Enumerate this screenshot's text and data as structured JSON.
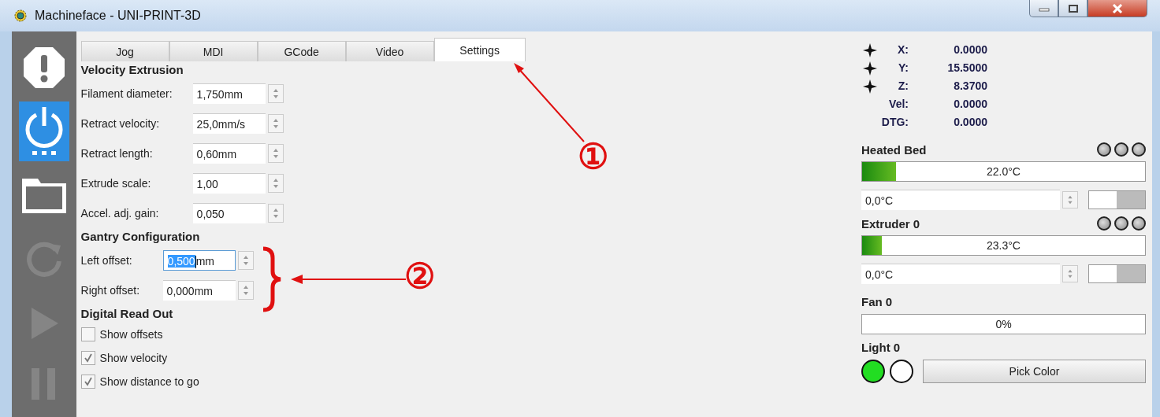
{
  "window": {
    "title": "Machineface - UNI-PRINT-3D"
  },
  "sidebar": [
    {
      "kind": "estop",
      "selected": false,
      "disabled": false
    },
    {
      "kind": "power",
      "selected": true,
      "disabled": false
    },
    {
      "kind": "folder",
      "selected": false,
      "disabled": false
    },
    {
      "kind": "reload",
      "selected": false,
      "disabled": true
    },
    {
      "kind": "play",
      "selected": false,
      "disabled": true
    },
    {
      "kind": "pause",
      "selected": false,
      "disabled": true
    }
  ],
  "tabs": [
    {
      "label": "Jog",
      "selected": false
    },
    {
      "label": "MDI",
      "selected": false
    },
    {
      "label": "GCode",
      "selected": false
    },
    {
      "label": "Video",
      "selected": false
    },
    {
      "label": "Settings",
      "selected": true
    }
  ],
  "settings": [
    {
      "title": "Velocity Extrusion",
      "kind": "spins",
      "fields": [
        {
          "label": "Filament diameter:",
          "value": "1,750mm",
          "focused": false
        },
        {
          "label": "Retract velocity:",
          "value": "25,0mm/s",
          "focused": false
        },
        {
          "label": "Retract length:",
          "value": "0,60mm",
          "focused": false
        },
        {
          "label": "Extrude scale:",
          "value": "1,00",
          "focused": false
        },
        {
          "label": "Accel. adj. gain:",
          "value": "0,050",
          "focused": false
        }
      ]
    },
    {
      "title": "Gantry Configuration",
      "kind": "spins",
      "fields": [
        {
          "label": "Left offset:",
          "selected_text": "0,500",
          "value": "mm",
          "focused": true
        },
        {
          "label": "Right offset:",
          "value": "0,000mm",
          "focused": false
        }
      ]
    },
    {
      "title": "Digital Read Out",
      "kind": "checks",
      "items": [
        {
          "label": "Show offsets",
          "checked": false
        },
        {
          "label": "Show velocity",
          "checked": true
        },
        {
          "label": "Show distance to go",
          "checked": true
        }
      ]
    }
  ],
  "annotations": [
    {
      "label": "①",
      "kind": "arrow"
    },
    {
      "label": "②",
      "kind": "brace"
    }
  ],
  "dro": [
    {
      "label": "X:",
      "value": "0.0000",
      "homed": true
    },
    {
      "label": "Y:",
      "value": "15.5000",
      "homed": true
    },
    {
      "label": "Z:",
      "value": "8.3700",
      "homed": true
    },
    {
      "label": "Vel:",
      "value": "0.0000",
      "homed": false
    },
    {
      "label": "DTG:",
      "value": "0.0000",
      "homed": false
    }
  ],
  "heaters": [
    {
      "title": "Heated Bed",
      "leds": [
        {
          "on": false
        },
        {
          "on": false
        },
        {
          "on": false
        }
      ],
      "level": 0.12,
      "reading": "22.0°C",
      "setpoint": "0,0°C",
      "enabled": false
    },
    {
      "title": "Extruder 0",
      "leds": [
        {
          "on": false
        },
        {
          "on": false
        },
        {
          "on": false
        }
      ],
      "level": 0.07,
      "reading": "23.3°C",
      "setpoint": "0,0°C",
      "enabled": false
    }
  ],
  "fan": {
    "title": "Fan 0",
    "level": 0,
    "reading": "0%"
  },
  "light": {
    "title": "Light 0",
    "swatches": [
      {
        "color": "#22dd22"
      },
      {
        "color": "#ffffff"
      }
    ],
    "button": "Pick Color"
  }
}
